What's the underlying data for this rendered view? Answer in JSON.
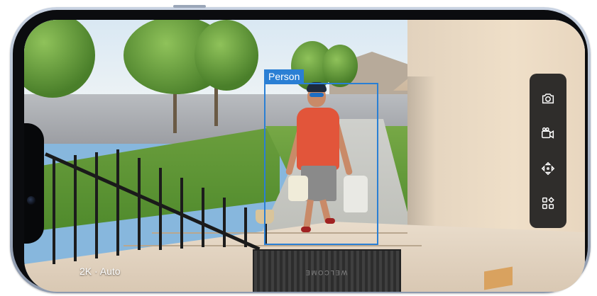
{
  "detection": {
    "label": "Person"
  },
  "stream": {
    "quality_label": "2K · Auto"
  },
  "doormat": {
    "text": "WELCOME"
  },
  "controls": [
    {
      "name": "snapshot",
      "icon": "camera-icon"
    },
    {
      "name": "record",
      "icon": "video-camera-icon"
    },
    {
      "name": "pan-tilt",
      "icon": "directional-arrows-icon"
    },
    {
      "name": "more",
      "icon": "grid-apps-icon"
    }
  ],
  "colors": {
    "detection_accent": "#2a7fd4",
    "panel_background": "#141416",
    "icon_color": "#ffffff"
  }
}
